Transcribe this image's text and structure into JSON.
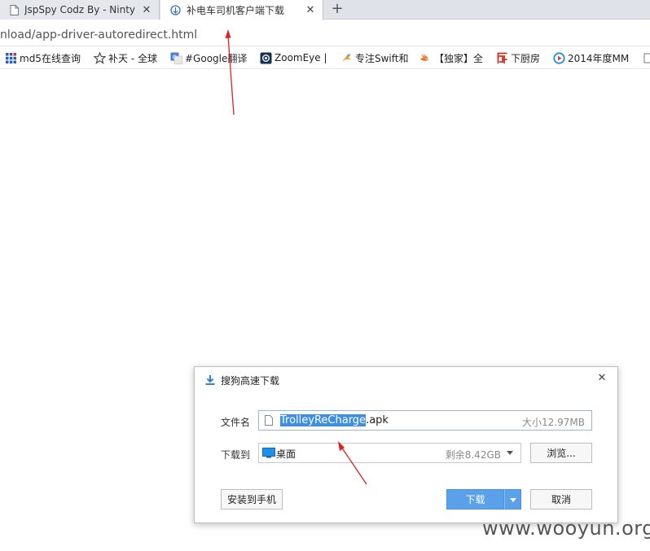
{
  "tabs": [
    {
      "label": "JspSpy Codz By - Ninty",
      "icon": "page-icon",
      "close": "✕"
    },
    {
      "label": "补电车司机客户端下载",
      "icon": "site-icon",
      "close": "✕"
    }
  ],
  "new_tab": "+",
  "address": {
    "url": "nload/app-driver-autoredirect.html"
  },
  "bookmarks": [
    {
      "label": "md5在线查询",
      "icon": "grid-icon",
      "color": "#2a5ea8"
    },
    {
      "label": "补天 - 全球",
      "icon": "star-icon",
      "color": "#555555"
    },
    {
      "label": "#Google翻译",
      "icon": "translate-icon",
      "color": "#4a7fd6"
    },
    {
      "label": "ZoomEye |",
      "icon": "eye-icon",
      "color": "#16334f"
    },
    {
      "label": "专注Swift和",
      "icon": "swift-bird-icon",
      "color": "#f0a030"
    },
    {
      "label": "【独家】全",
      "icon": "swift-icon",
      "color": "#f07020"
    },
    {
      "label": "下厨房",
      "icon": "kitchen-icon",
      "color": "#d03020"
    },
    {
      "label": "2014年度MM",
      "icon": "play-icon",
      "color": "#1e8fe0"
    },
    {
      "label": "",
      "icon": "folder-icon",
      "color": "#777777"
    }
  ],
  "dialog": {
    "title": "搜狗高速下载",
    "close": "✕",
    "file_label": "文件名",
    "file_name_selected": "TrolleyReCharge",
    "file_name_ext": ".apk",
    "file_size": "大小12.97MB",
    "save_label": "下载到",
    "save_location": "桌面",
    "free_space": "剩余8.42GB",
    "browse_label": "浏览...",
    "install_label": "安装到手机",
    "download_label": "下载",
    "cancel_label": "取消"
  },
  "colors": {
    "accent": "#5aa0ea",
    "arrow": "#e02020",
    "selection": "#3f8fe0"
  },
  "watermark": "www.wooyun.org"
}
